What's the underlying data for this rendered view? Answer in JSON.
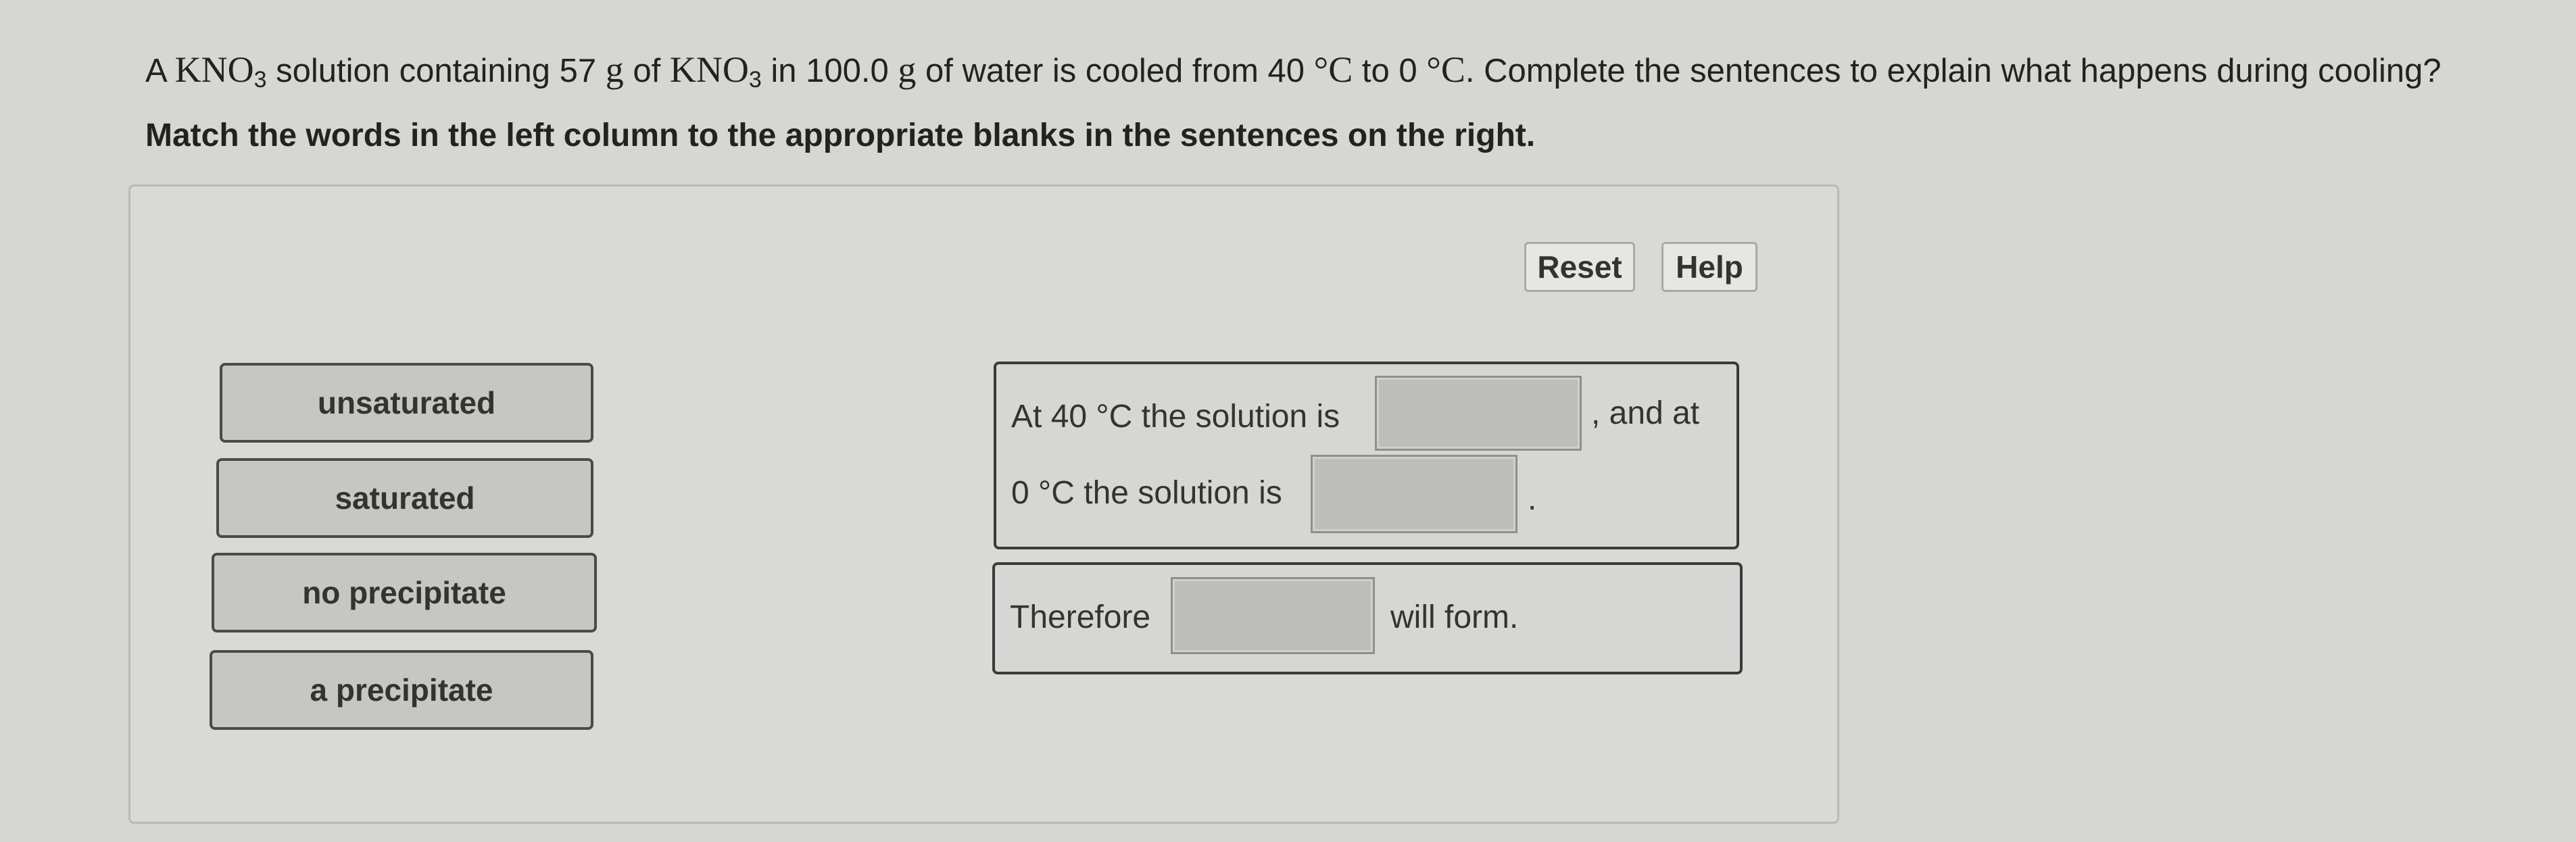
{
  "question": {
    "p1": "A ",
    "chem1": "KNO",
    "sub1": "3",
    "p2": " solution containing 57 ",
    "unit_g1": "g",
    "p3": " of ",
    "chem2": "KNO",
    "sub2": "3",
    "p4": " in 100.0 ",
    "unit_g2": "g",
    "p5": " of water is cooled from 40 ",
    "deg1": "°C",
    "p6": " to 0 ",
    "deg2": "°C",
    "p7": ". Complete the sentences to explain what happens during cooling?"
  },
  "instruction": "Match the words in the left column to the appropriate blanks in the sentences on the right.",
  "toolbar": {
    "reset_label": "Reset",
    "help_label": "Help"
  },
  "words": [
    "unsaturated",
    "saturated",
    "no precipitate",
    "a precipitate"
  ],
  "sentence1": {
    "part1": "At 40 °C the solution is",
    "part2": ", and at",
    "part3": "0 °C the solution is",
    "part4": "."
  },
  "sentence2": {
    "part1": "Therefore",
    "part2": "will form."
  }
}
